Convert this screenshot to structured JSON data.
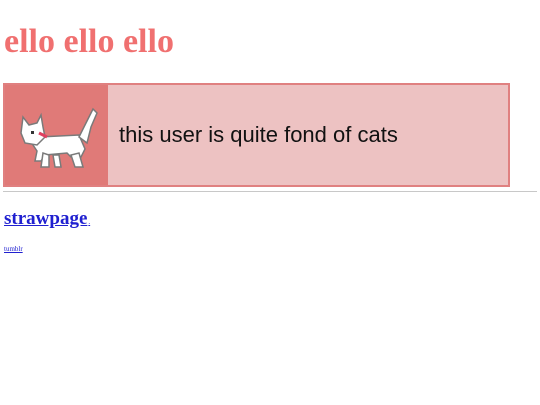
{
  "page": {
    "title": "ello ello ello"
  },
  "userbox": {
    "text": "this user is quite fond of cats",
    "image_icon": "white-cat-icon"
  },
  "links": {
    "site_label": "strawpage",
    "site_suffix": ".",
    "tumblr_label": "tumblr"
  },
  "colors": {
    "title": "#f07070",
    "userbox_border": "#e08080",
    "userbox_image_bg": "#e07a78",
    "userbox_text_bg": "#edc2c2",
    "link": "#2020d0",
    "cat_collar": "#e04060"
  }
}
